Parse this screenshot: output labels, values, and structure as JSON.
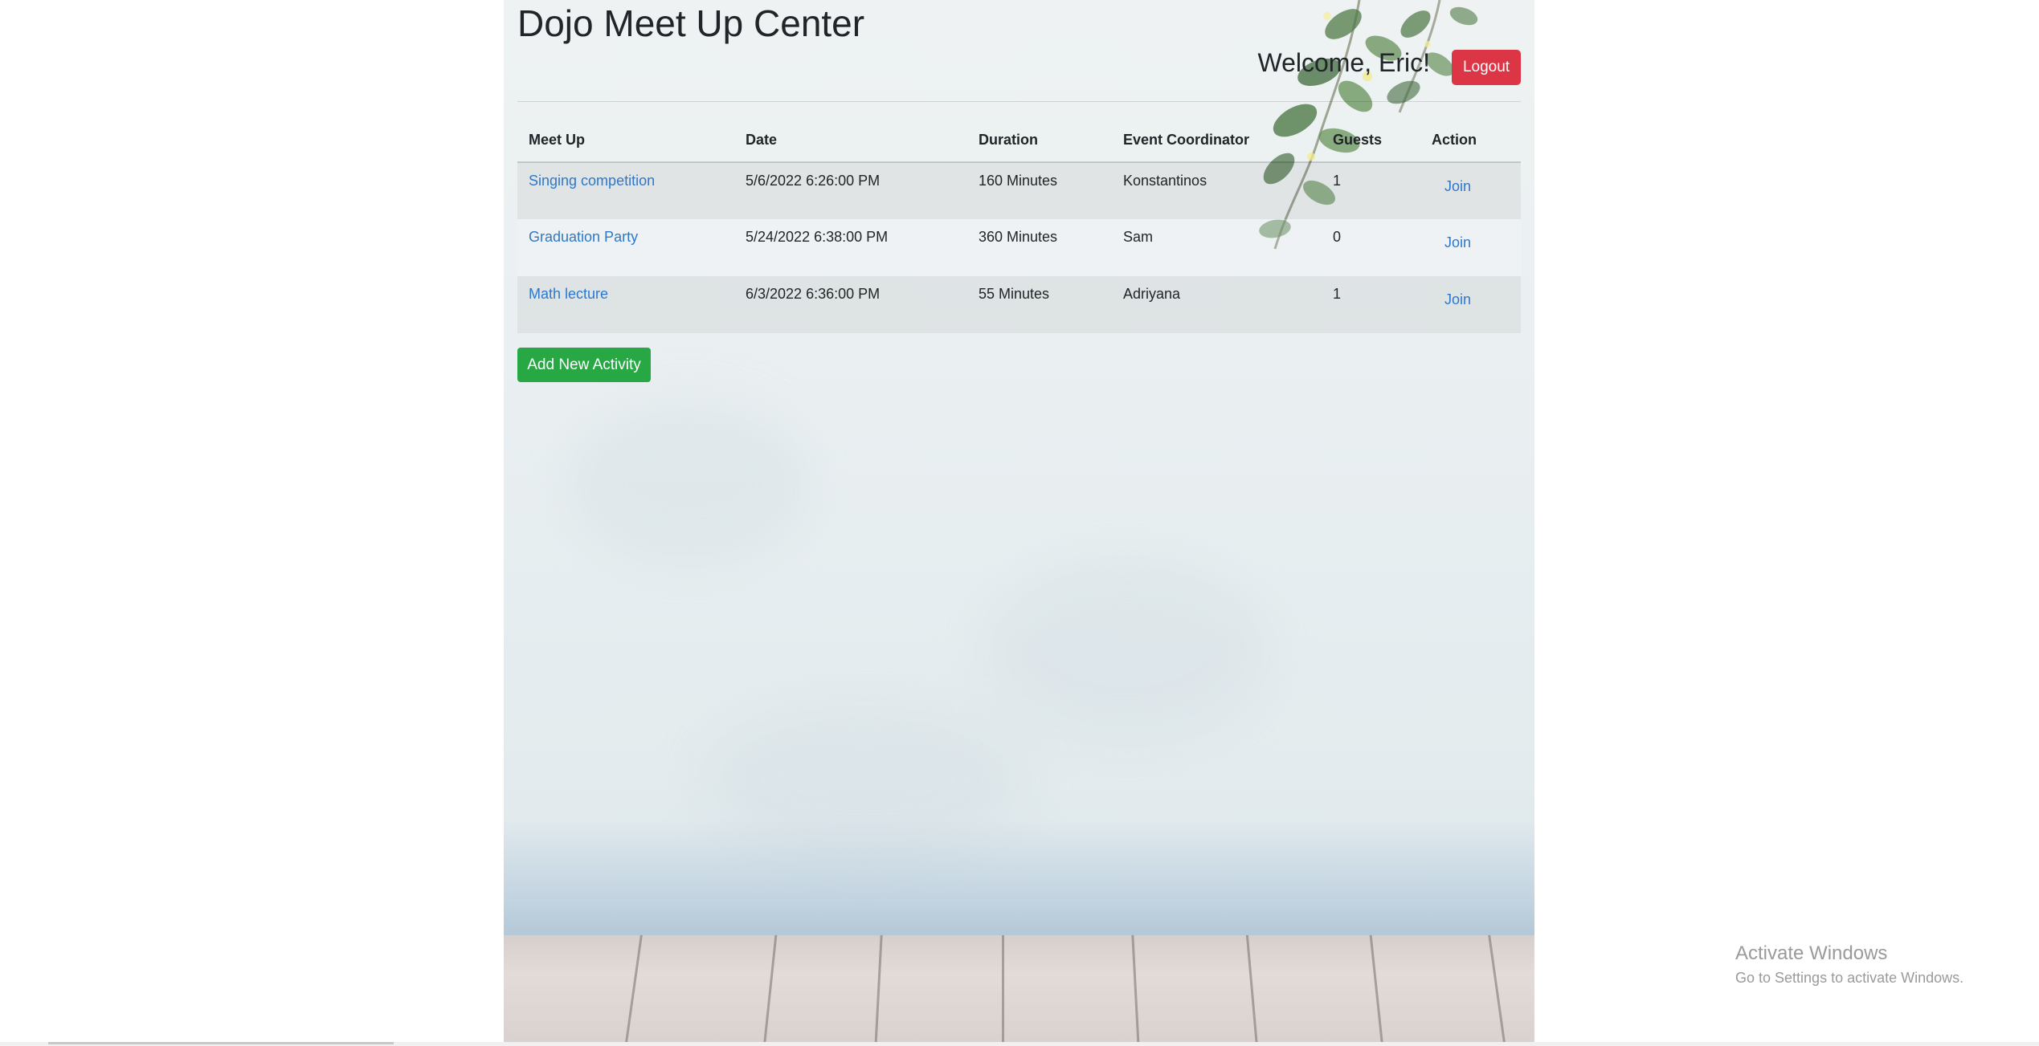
{
  "header": {
    "title": "Dojo Meet Up Center",
    "welcome": "Welcome, Eric!",
    "logout_label": "Logout"
  },
  "table": {
    "columns": [
      "Meet Up",
      "Date",
      "Duration",
      "Event Coordinator",
      "Guests",
      "Action"
    ],
    "rows": [
      {
        "meetup": "Singing competition",
        "date": "5/6/2022 6:26:00 PM",
        "duration": "160 Minutes",
        "coordinator": "Konstantinos",
        "guests": "1",
        "action": "Join"
      },
      {
        "meetup": "Graduation Party",
        "date": "5/24/2022 6:38:00 PM",
        "duration": "360 Minutes",
        "coordinator": "Sam",
        "guests": "0",
        "action": "Join"
      },
      {
        "meetup": "Math lecture",
        "date": "6/3/2022 6:36:00 PM",
        "duration": "55 Minutes",
        "coordinator": "Adriyana",
        "guests": "1",
        "action": "Join"
      }
    ]
  },
  "add_button_label": "Add New Activity",
  "watermark": {
    "title": "Activate Windows",
    "subtitle": "Go to Settings to activate Windows."
  },
  "colors": {
    "logout": "#dc3545",
    "add": "#28a745",
    "link": "#2e78c9"
  }
}
